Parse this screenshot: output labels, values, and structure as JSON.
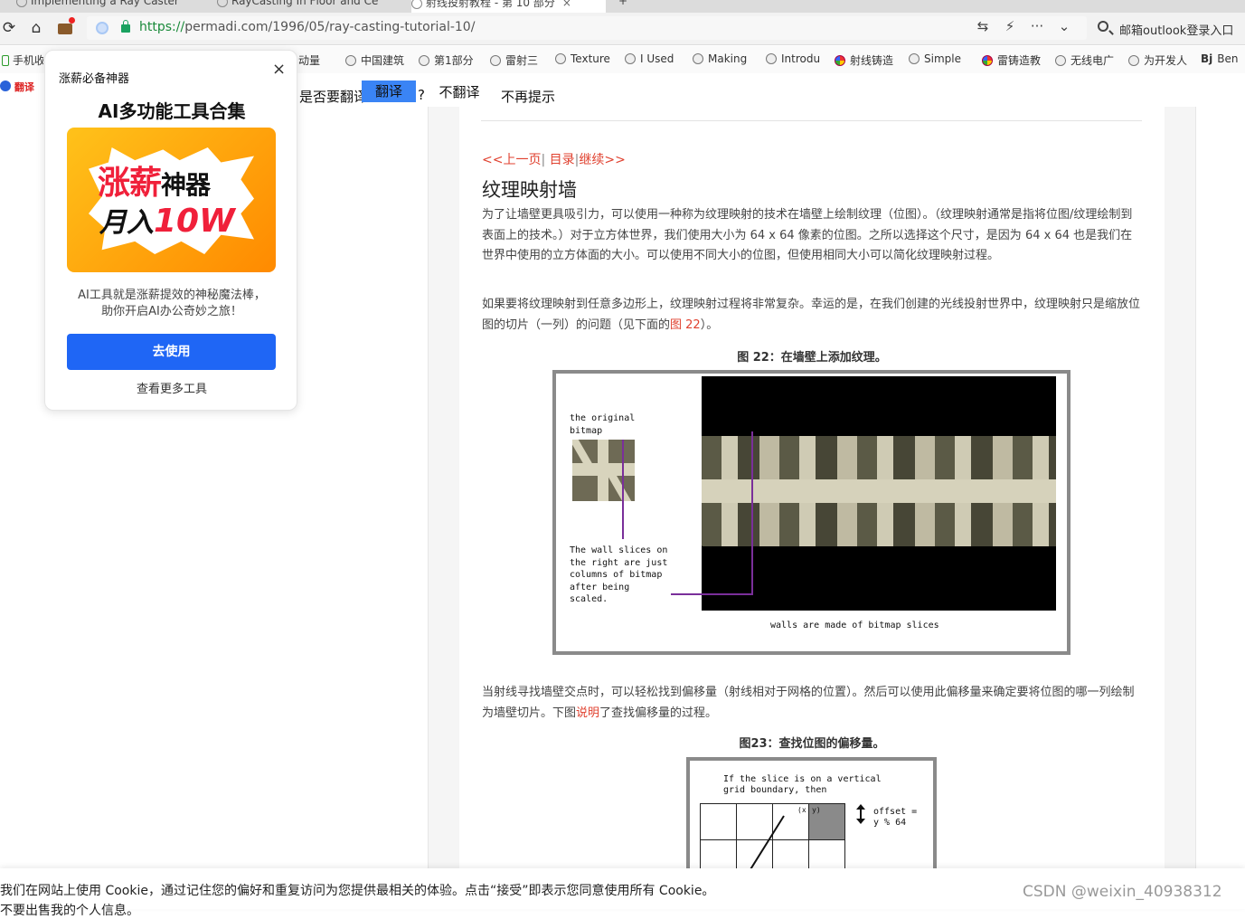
{
  "tabs": [
    {
      "label": "Implementing a Ray Caster",
      "active": false
    },
    {
      "label": "RayCasting In Floor and Ce",
      "active": false
    },
    {
      "label": "射线投射教程 - 第 10 部分",
      "active": true
    }
  ],
  "addressbar": {
    "url_scheme": "https://",
    "url_rest": "permadi.com/1996/05/ray-casting-tutorial-10/",
    "search_text": "邮箱outlook登录入口"
  },
  "bookmarks": [
    {
      "label": "手机收"
    },
    {
      "label": "动量"
    },
    {
      "label": "中国建筑"
    },
    {
      "label": "第1部分"
    },
    {
      "label": "雷射三"
    },
    {
      "label": "Texture"
    },
    {
      "label": "I Used"
    },
    {
      "label": "Making"
    },
    {
      "label": "Introdu"
    },
    {
      "label": "射线铸造"
    },
    {
      "label": "Simple"
    },
    {
      "label": "雷铸造教"
    },
    {
      "label": "无线电广"
    },
    {
      "label": "为开发人"
    },
    {
      "label": "Ben"
    }
  ],
  "translate_bar": {
    "logo": "翻译",
    "question": "是否要翻译",
    "translate_btn": "翻译",
    "question_mark": "?",
    "no_btn": "不翻译",
    "never_btn": "不再提示"
  },
  "popup": {
    "header": "涨薪必备神器",
    "close": "×",
    "title": "AI多功能工具合集",
    "banner_line1": "涨薪",
    "banner_line1b": "神器",
    "banner_line2": "月入",
    "banner_line2b": "10W",
    "desc_line1": "AI工具就是涨薪提效的神秘魔法棒，",
    "desc_line2": "助你开启AI办公奇妙之旅！",
    "use_btn": "去使用",
    "more_link": "查看更多工具"
  },
  "article": {
    "nav_prev": "<<上一页",
    "nav_toc": "目录",
    "nav_next": "继续>>",
    "nav_sep": "|",
    "title": "纹理映射墙",
    "p1": "为了让墙壁更具吸引力，可以使用一种称为纹理映射的技术在墙壁上绘制纹理（位图）。（纹理映射通常是指将位图/纹理绘制到表面上的技术。）对于立方体世界，我们使用大小为 64 x 64 像素的位图。之所以选择这个尺寸，是因为 64 x 64 也是我们在世界中使用的立方体面的大小。可以使用不同大小的位图，但使用相同大小可以简化纹理映射过程。",
    "p2_a": "如果要将纹理映射到任意多边形上，纹理映射过程将非常复杂。幸运的是，在我们创建的光线投射世界中，纹理映射只是缩放位图的切片（一列）的问题（见下面的",
    "p2_link": "图 22",
    "p2_b": "）。",
    "fig22_caption": "图 22：在墙壁上添加纹理。",
    "fig22_label_a": "the original\nbitmap",
    "fig22_label_b": "The wall slices on\nthe right are just\ncolumns of bitmap\nafter being\nscaled.",
    "fig22_label_c": "walls are made of bitmap slices",
    "p3_a": "当射线寻找墙壁交点时，可以轻松找到偏移量（射线相对于网格的位置）。然后可以使用此偏移量来确定要将位图的哪一列绘制为墙壁切片。下图",
    "p3_link": "说明",
    "p3_b": "了查找偏移量的过程。",
    "fig23_caption": "图23：查找位图的偏移量。",
    "fig23_label_a": "If the slice is on a vertical\ngrid boundary, then",
    "fig23_label_b": "offset =\ny % 64",
    "fig23_label_c": "(x",
    "fig23_label_d": "y)"
  },
  "cookie": {
    "line1": "我们在网站上使用 Cookie，通过记住您的偏好和重复访问为您提供最相关的体验。点击“接受”即表示您同意使用所有 Cookie。",
    "line2": "不要出售我的个人信息。",
    "watermark": "CSDN @weixin_40938312"
  }
}
